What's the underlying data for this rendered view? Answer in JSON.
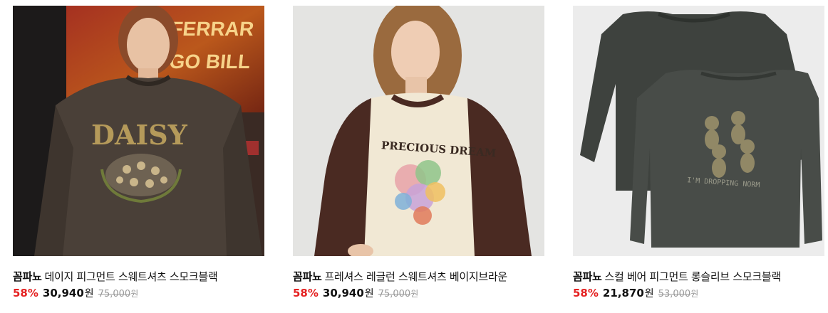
{
  "products": [
    {
      "brand": "꼼파뇨",
      "name": "데이지 피그먼트 스웨트셔츠 스모크블랙",
      "discount": "58%",
      "price": "30,940",
      "currency": "원",
      "original_price": "75,000",
      "original_currency": "원",
      "image_art": {
        "print_text": "DAISY",
        "backdrop_text_1": "FERRAR",
        "backdrop_text_2": "GO BILL"
      }
    },
    {
      "brand": "꼼파뇨",
      "name": "프레셔스 레글런 스웨트셔츠 베이지브라운",
      "discount": "58%",
      "price": "30,940",
      "currency": "원",
      "original_price": "75,000",
      "original_currency": "원",
      "image_art": {
        "print_text": "PRECIOUS DREAM"
      }
    },
    {
      "brand": "꼼파뇨",
      "name": "스컬 베어 피그먼트 롱슬리브 스모크블랙",
      "discount": "58%",
      "price": "21,870",
      "currency": "원",
      "original_price": "53,000",
      "original_currency": "원",
      "image_art": {
        "print_text": "I'M DROPPING NORM"
      }
    }
  ],
  "colors": {
    "discount": "#e52222",
    "original_price": "#9a9a9a"
  }
}
